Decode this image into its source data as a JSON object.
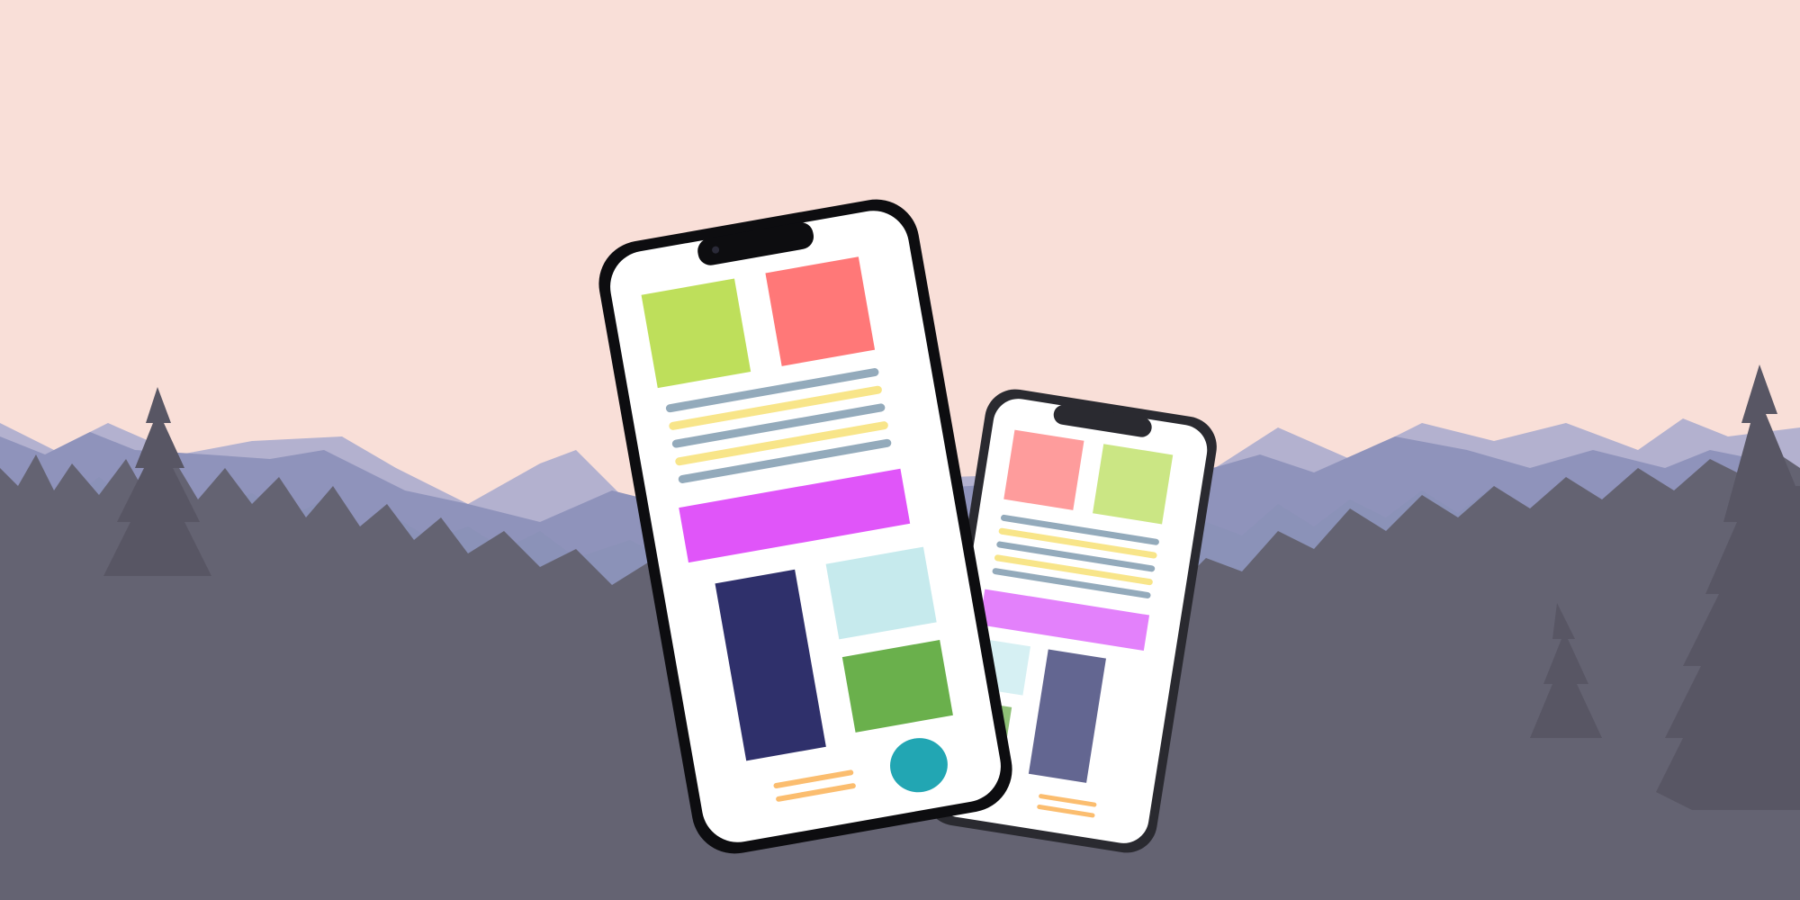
{
  "scene": {
    "description_free": true,
    "colors": {
      "sky": "#f9dfd8",
      "mountain_far": "#b3b1cf",
      "mountain_mid": "#8f93bb",
      "forest_mid": "#8b92b8",
      "forest_near": "#646372",
      "tree_dark": "#585664"
    }
  },
  "phones": [
    {
      "id": "front",
      "frame_color": "#0d0d10",
      "screen_color": "#ffffff",
      "blocks": [
        {
          "kind": "tile",
          "color": "#bedf5b"
        },
        {
          "kind": "tile",
          "color": "#ff7878"
        },
        {
          "kind": "text-line",
          "color": "#93aabb"
        },
        {
          "kind": "text-line",
          "color": "#f8e589"
        },
        {
          "kind": "text-line",
          "color": "#93aabb"
        },
        {
          "kind": "text-line",
          "color": "#f8e589"
        },
        {
          "kind": "text-line",
          "color": "#93aabb"
        },
        {
          "kind": "banner",
          "color": "#e055f9"
        },
        {
          "kind": "tall-tile",
          "color": "#2f306b"
        },
        {
          "kind": "tile",
          "color": "#c6eaed"
        },
        {
          "kind": "tile",
          "color": "#6ab04c"
        },
        {
          "kind": "fab",
          "color": "#22a6b3"
        },
        {
          "kind": "text-line",
          "color": "#fbbd6f"
        }
      ]
    },
    {
      "id": "back",
      "frame_color": "#2a2a30",
      "screen_color": "#ffffff",
      "blocks": [
        {
          "kind": "tile",
          "color": "#fe9c9c"
        },
        {
          "kind": "tile",
          "color": "#cbe684"
        },
        {
          "kind": "banner",
          "color": "#e381fb"
        },
        {
          "kind": "tile",
          "color": "#d6f0f3"
        },
        {
          "kind": "tall-tile",
          "color": "#636691"
        },
        {
          "kind": "tile",
          "color": "#8fc077"
        },
        {
          "kind": "fab",
          "color": "#5ebfc7"
        }
      ]
    }
  ]
}
